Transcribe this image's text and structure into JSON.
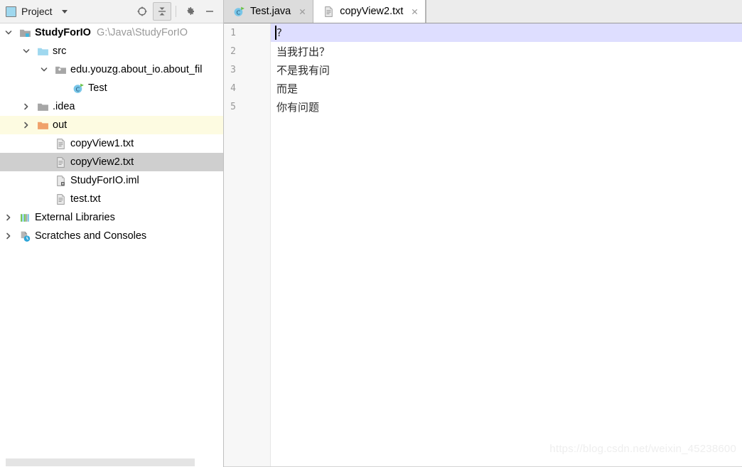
{
  "window": {
    "watermark": "https://blog.csdn.net/weixin_45238600"
  },
  "sidebar": {
    "title": "Project",
    "title_icon": "project-panel-icon",
    "dropdown_icon": "chevron-down-icon",
    "actions": [
      {
        "name": "locate-in-tree-button",
        "icon": "crosshair-target-icon",
        "pressed": false
      },
      {
        "name": "collapse-all-button",
        "icon": "collapse-all-icon",
        "pressed": true
      },
      {
        "name": "settings-button",
        "icon": "gear-icon",
        "pressed": false
      },
      {
        "name": "hide-panel-button",
        "icon": "minimize-icon",
        "pressed": false
      }
    ],
    "scrollbar": {
      "name": "horizontal-scrollbar"
    },
    "tree": [
      {
        "label": "StudyForIO",
        "secondary": "G:\\Java\\StudyForIO",
        "icon": "module-folder-icon",
        "indent": 0,
        "arrow": "expanded",
        "bold": true,
        "state": "normal"
      },
      {
        "label": "src",
        "secondary": "",
        "icon": "source-root-folder-icon",
        "indent": 1,
        "arrow": "expanded",
        "bold": false,
        "state": "normal"
      },
      {
        "label": "edu.youzg.about_io.about_fil",
        "secondary": "",
        "icon": "package-folder-icon",
        "indent": 2,
        "arrow": "expanded",
        "bold": false,
        "state": "normal"
      },
      {
        "label": "Test",
        "secondary": "",
        "icon": "java-class-runnable-icon",
        "indent": 3,
        "arrow": "none",
        "bold": false,
        "state": "normal"
      },
      {
        "label": ".idea",
        "secondary": "",
        "icon": "folder-icon",
        "indent": 1,
        "arrow": "collapsed",
        "bold": false,
        "state": "normal"
      },
      {
        "label": "out",
        "secondary": "",
        "icon": "excluded-folder-icon",
        "indent": 1,
        "arrow": "collapsed",
        "bold": false,
        "state": "excluded"
      },
      {
        "label": "copyView1.txt",
        "secondary": "",
        "icon": "text-file-icon",
        "indent": 2,
        "arrow": "none",
        "bold": false,
        "state": "normal"
      },
      {
        "label": "copyView2.txt",
        "secondary": "",
        "icon": "text-file-icon",
        "indent": 2,
        "arrow": "none",
        "bold": false,
        "state": "selected"
      },
      {
        "label": "StudyForIO.iml",
        "secondary": "",
        "icon": "iml-file-icon",
        "indent": 2,
        "arrow": "none",
        "bold": false,
        "state": "normal"
      },
      {
        "label": "test.txt",
        "secondary": "",
        "icon": "text-file-icon",
        "indent": 2,
        "arrow": "none",
        "bold": false,
        "state": "normal"
      },
      {
        "label": "External Libraries",
        "secondary": "",
        "icon": "libraries-icon",
        "indent": 0,
        "arrow": "collapsed",
        "bold": false,
        "state": "normal"
      },
      {
        "label": "Scratches and Consoles",
        "secondary": "",
        "icon": "scratches-icon",
        "indent": 0,
        "arrow": "collapsed",
        "bold": false,
        "state": "normal"
      }
    ]
  },
  "editor": {
    "tabs": [
      {
        "label": "Test.java",
        "icon": "java-class-runnable-icon",
        "active": false,
        "close_icon": "close-icon"
      },
      {
        "label": "copyView2.txt",
        "icon": "text-file-icon",
        "active": true,
        "close_icon": "close-icon"
      }
    ],
    "lines": [
      {
        "number": "1",
        "text": "?",
        "current": true
      },
      {
        "number": "2",
        "text": "当我打出？",
        "current": false
      },
      {
        "number": "3",
        "text": "不是我有问",
        "current": false
      },
      {
        "number": "4",
        "text": "而是",
        "current": false
      },
      {
        "number": "5",
        "text": "你有问题",
        "current": false
      }
    ]
  },
  "colors": {
    "selection": "#cfcfcf",
    "excluded_row": "#fdfbe1",
    "current_line": "#dedeff",
    "panel_bg": "#f2f2f2",
    "tab_inactive": "#dcdcdc"
  }
}
